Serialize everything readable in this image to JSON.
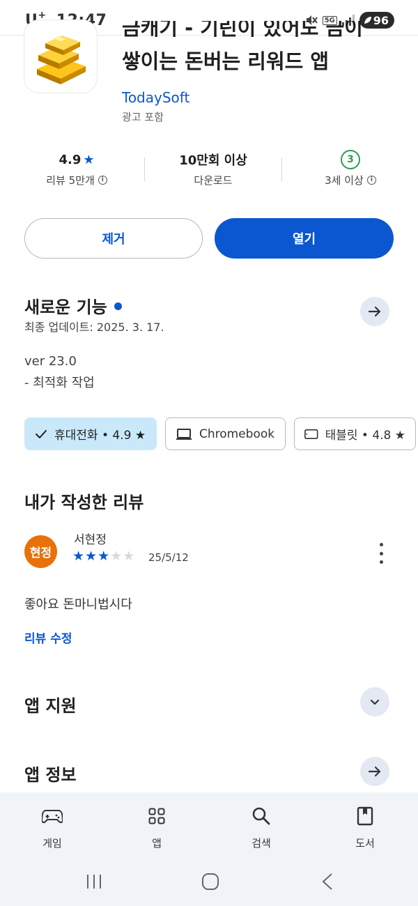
{
  "status_bar": {
    "carrier": "U",
    "carrier_sup": "+",
    "time": "12:47",
    "network": "5G",
    "battery": "96"
  },
  "app": {
    "title_line1": "금캐기 - 기린이 있어도 금이",
    "title_line2": "쌓이는 돈버는 리워드 앱",
    "developer": "TodaySoft",
    "contains_ads": "광고 포함",
    "icon": "gold-bars-icon"
  },
  "stats": {
    "rating_value": "4.9",
    "rating_label": "리뷰 5만개",
    "downloads_value": "10만회 이상",
    "downloads_label": "다운로드",
    "age_value": "3",
    "age_label": "3세 이상"
  },
  "actions": {
    "remove_label": "제거",
    "open_label": "열기"
  },
  "whats_new": {
    "title": "새로운 기능",
    "updated": "최종 업데이트: 2025. 3. 17.",
    "version": "ver 23.0",
    "note": "- 최적화 작업"
  },
  "device_chips": [
    {
      "label": "휴대전화 • 4.9 ★",
      "active": true
    },
    {
      "label": "Chromebook",
      "active": false
    },
    {
      "label": "태블릿 • 4.8 ★",
      "active": false
    }
  ],
  "my_review": {
    "section_title": "내가 작성한 리뷰",
    "avatar_text": "현정",
    "reviewer_name": "서현정",
    "rating": 3,
    "max_rating": 5,
    "date": "25/5/12",
    "text": "좋아요 돈마니법시다",
    "edit_label": "리뷰 수정"
  },
  "sections": {
    "app_support": "앱 지원",
    "app_info": "앱 정보"
  },
  "bottom_nav": [
    {
      "label": "게임",
      "icon": "gamepad-icon"
    },
    {
      "label": "앱",
      "icon": "apps-grid-icon"
    },
    {
      "label": "검색",
      "icon": "search-icon"
    },
    {
      "label": "도서",
      "icon": "book-icon"
    }
  ],
  "colors": {
    "accent": "#0b57d0",
    "chip_active": "#c9e9fb",
    "avatar": "#e8710a",
    "age_green": "#2e9a55",
    "nav_bg": "#f0f4f9"
  }
}
